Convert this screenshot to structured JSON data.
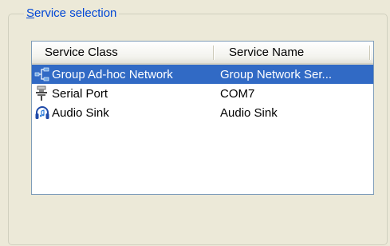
{
  "groupbox": {
    "legend_first": "S",
    "legend_rest": "ervice selection"
  },
  "listview": {
    "columns": [
      "Service Class",
      "Service Name"
    ],
    "rows": [
      {
        "service_class": "Group Ad-hoc Network",
        "service_name": "Group Network Ser...",
        "icon": "network-icon",
        "selected": true
      },
      {
        "service_class": "Serial Port",
        "service_name": "COM7",
        "icon": "serial-port-icon",
        "selected": false
      },
      {
        "service_class": "Audio Sink",
        "service_name": "Audio Sink",
        "icon": "headphones-icon",
        "selected": false
      }
    ]
  },
  "colors": {
    "selection": "#316ac5",
    "legend_text": "#0046d5",
    "background": "#ece9d8"
  }
}
